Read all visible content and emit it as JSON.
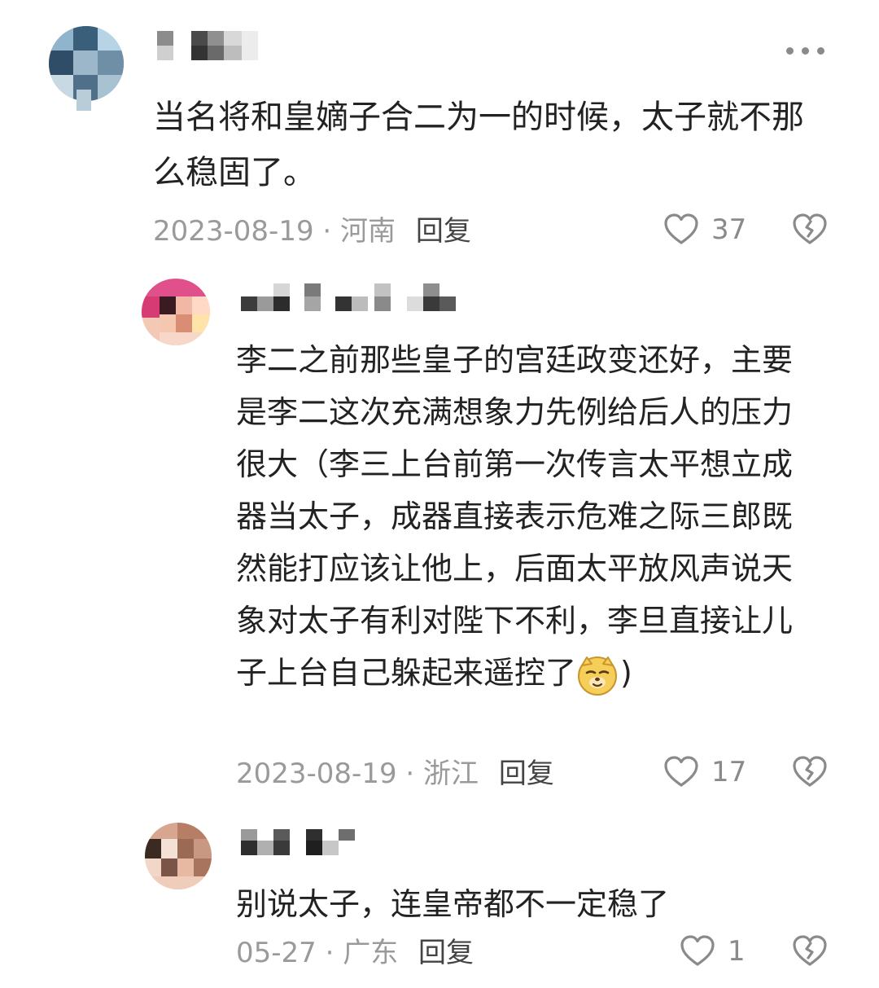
{
  "comments": [
    {
      "text": "当名将和皇嫡子合二为一的时候，太子就不那么稳固了。",
      "date": "2023-08-19",
      "separator": "·",
      "location": "河南",
      "reply_label": "回复",
      "likes": "37"
    },
    {
      "text": "李二之前那些皇子的宫廷政变还好，主要是李二这次充满想象力先例给后人的压力很大（李三上台前第一次传言太平想立成器当太子，成器直接表示危难之际三郎既然能打应该让他上，后面太平放风声说天象对太子有利对陛下不利，李旦直接让儿子上台自己躲起来遥控了",
      "text_tail": ")",
      "date": "2023-08-19",
      "separator": "·",
      "location": "浙江",
      "reply_label": "回复",
      "likes": "17"
    },
    {
      "text": "别说太子，连皇帝都不一定稳了",
      "date": "05-27",
      "separator": "·",
      "location": "广东",
      "reply_label": "回复",
      "likes": "1"
    }
  ],
  "icons": {
    "like": "heart-outline-icon",
    "dislike": "broken-heart-icon",
    "more": "more-dots-icon",
    "emoji": "dog-face-emoji-icon"
  },
  "colors": {
    "text": "#222222",
    "meta": "#9a9a9a",
    "icon": "#8a8a8a"
  }
}
